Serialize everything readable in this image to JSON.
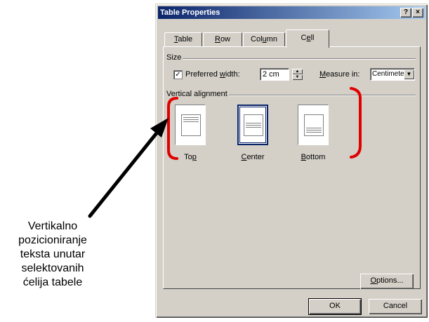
{
  "dialog": {
    "title": "Table Properties",
    "help_btn": "?",
    "close_btn": "×",
    "tabs": [
      {
        "pre": "",
        "key": "T",
        "post": "able"
      },
      {
        "pre": "",
        "key": "R",
        "post": "ow"
      },
      {
        "pre": "Col",
        "key": "u",
        "post": "mn"
      },
      {
        "pre": "C",
        "key": "e",
        "post": "ll"
      }
    ],
    "size_label": "Size",
    "preferred_width": {
      "pre": "Preferred ",
      "key": "w",
      "post": "idth:",
      "checked": "✓",
      "value": "2 cm"
    },
    "measure": {
      "key": "M",
      "post": "easure in:",
      "value": "Centimeter"
    },
    "vertical_alignment_label": "Vertical alignment",
    "alignments": [
      {
        "pre": "To",
        "key": "p",
        "post": ""
      },
      {
        "pre": "",
        "key": "C",
        "post": "enter"
      },
      {
        "pre": "",
        "key": "B",
        "post": "ottom"
      }
    ],
    "options_btn": {
      "key": "O",
      "post": "ptions..."
    },
    "ok_label": "OK",
    "cancel_label": "Cancel"
  },
  "annotation": {
    "lines": [
      "Vertikalno",
      "pozicioniranje",
      "teksta unutar",
      "selektovanih",
      "ćelija tabele"
    ],
    "bracket_color": "#e00000",
    "arrow_color": "#000000"
  }
}
